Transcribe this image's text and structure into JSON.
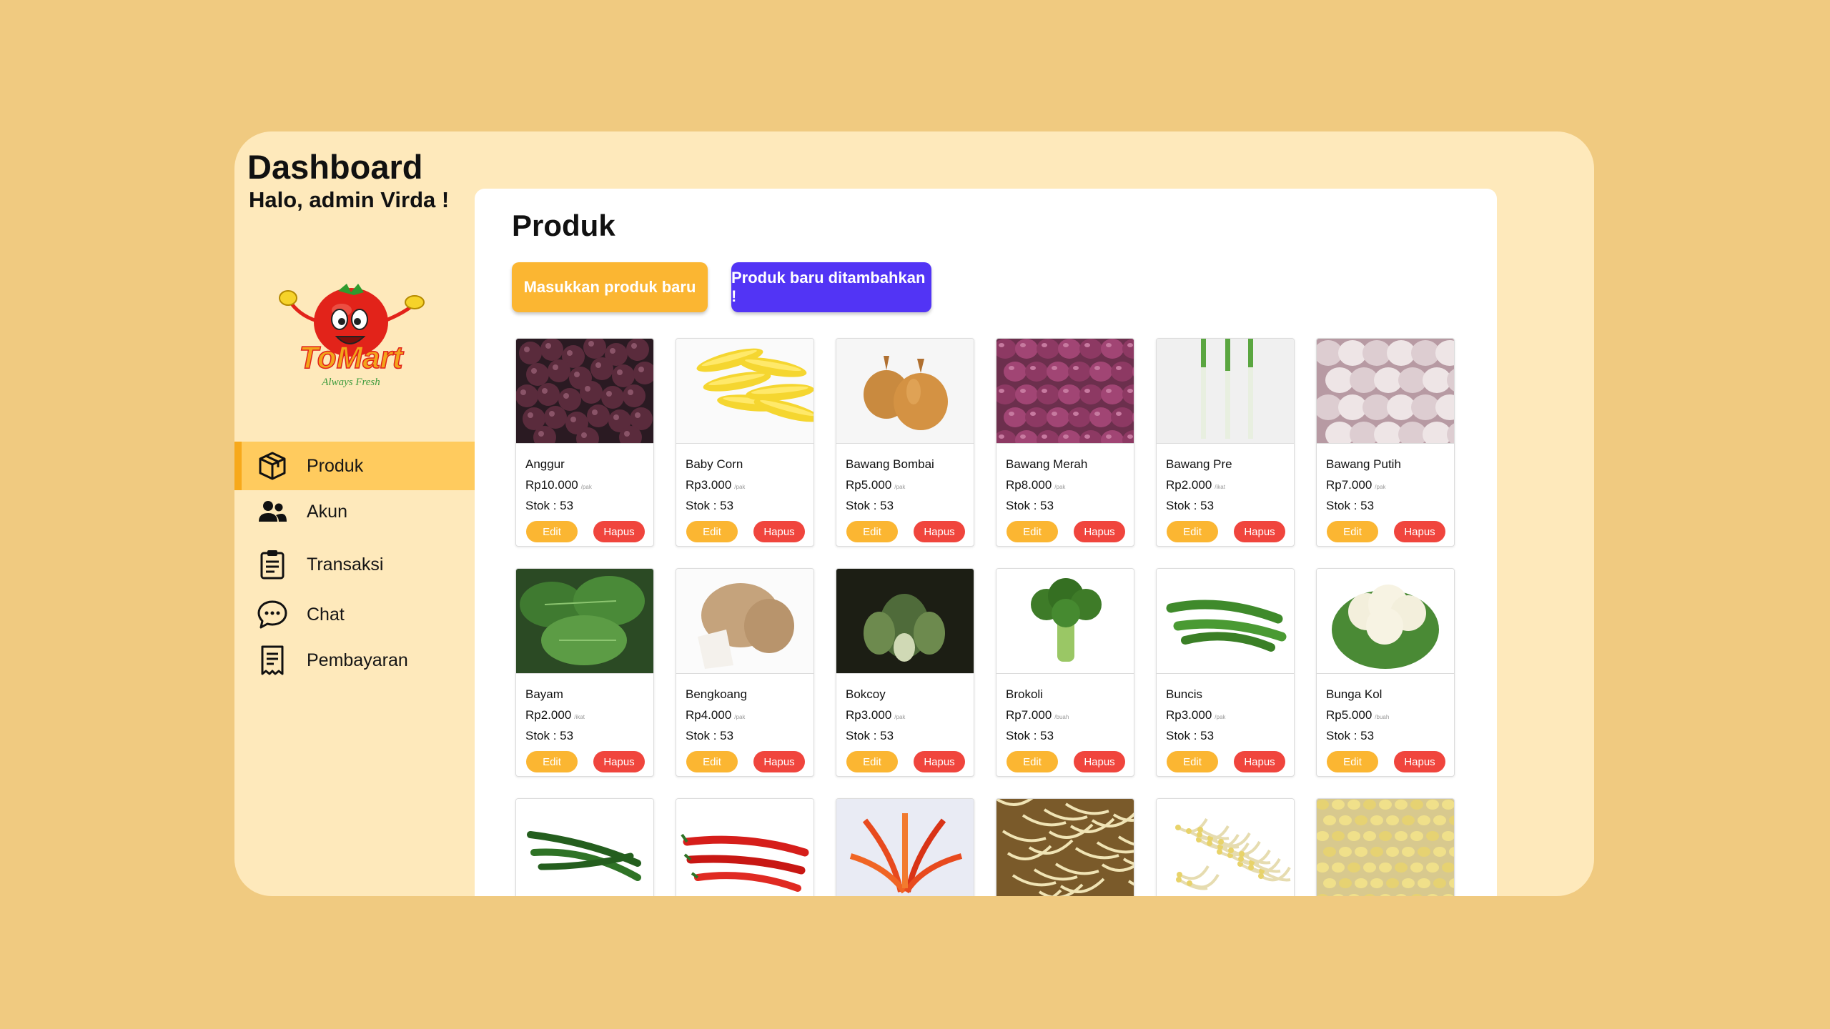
{
  "header": {
    "title": "Dashboard",
    "greeting": "Halo, admin Virda !"
  },
  "logo": {
    "text": "ToMart",
    "tagline": "Always Fresh"
  },
  "sidebar": {
    "items": [
      {
        "label": "Produk",
        "icon": "box-icon",
        "active": true
      },
      {
        "label": "Akun",
        "icon": "users-icon",
        "active": false
      },
      {
        "label": "Transaksi",
        "icon": "clipboard-icon",
        "active": false
      },
      {
        "label": "Chat",
        "icon": "chat-bubble-icon",
        "active": false
      },
      {
        "label": "Pembayaran",
        "icon": "receipt-icon",
        "active": false
      }
    ]
  },
  "main": {
    "title": "Produk",
    "add_button": "Masukkan produk baru",
    "notice": "Produk baru ditambahkan !",
    "edit_label": "Edit",
    "delete_label": "Hapus",
    "products": [
      {
        "name": "Anggur",
        "price": "Rp10.000",
        "unit": "/pak",
        "stock": "Stok : 53",
        "image": "grapes"
      },
      {
        "name": "Baby Corn",
        "price": "Rp3.000",
        "unit": "/pak",
        "stock": "Stok : 53",
        "image": "baby-corn"
      },
      {
        "name": "Bawang Bombai",
        "price": "Rp5.000",
        "unit": "/pak",
        "stock": "Stok : 53",
        "image": "onion"
      },
      {
        "name": "Bawang Merah",
        "price": "Rp8.000",
        "unit": "/pak",
        "stock": "Stok : 53",
        "image": "shallot"
      },
      {
        "name": "Bawang Pre",
        "price": "Rp2.000",
        "unit": "/ikat",
        "stock": "Stok : 53",
        "image": "leek"
      },
      {
        "name": "Bawang Putih",
        "price": "Rp7.000",
        "unit": "/pak",
        "stock": "Stok : 53",
        "image": "garlic"
      },
      {
        "name": "Bayam",
        "price": "Rp2.000",
        "unit": "/ikat",
        "stock": "Stok : 53",
        "image": "spinach"
      },
      {
        "name": "Bengkoang",
        "price": "Rp4.000",
        "unit": "/pak",
        "stock": "Stok : 53",
        "image": "jicama"
      },
      {
        "name": "Bokcoy",
        "price": "Rp3.000",
        "unit": "/pak",
        "stock": "Stok : 53",
        "image": "bokchoy"
      },
      {
        "name": "Brokoli",
        "price": "Rp7.000",
        "unit": "/buah",
        "stock": "Stok : 53",
        "image": "broccoli"
      },
      {
        "name": "Buncis",
        "price": "Rp3.000",
        "unit": "/pak",
        "stock": "Stok : 53",
        "image": "green-beans"
      },
      {
        "name": "Bunga Kol",
        "price": "Rp5.000",
        "unit": "/buah",
        "stock": "Stok : 53",
        "image": "cauliflower"
      },
      {
        "name": "",
        "price": "",
        "unit": "",
        "stock": "",
        "image": "green-chili"
      },
      {
        "name": "",
        "price": "",
        "unit": "",
        "stock": "",
        "image": "red-chili"
      },
      {
        "name": "",
        "price": "",
        "unit": "",
        "stock": "",
        "image": "bird-chili"
      },
      {
        "name": "",
        "price": "",
        "unit": "",
        "stock": "",
        "image": "bean-sprouts"
      },
      {
        "name": "",
        "price": "",
        "unit": "",
        "stock": "",
        "image": "bean-sprouts-white"
      },
      {
        "name": "",
        "price": "",
        "unit": "",
        "stock": "",
        "image": "soybean-sprouts"
      }
    ]
  },
  "colors": {
    "page_bg": "#f0ca80",
    "panel_bg": "#fee9bb",
    "accent": "#fbb632",
    "notice": "#5234f5",
    "danger": "#f0453d",
    "active_nav": "#ffcb5e"
  }
}
